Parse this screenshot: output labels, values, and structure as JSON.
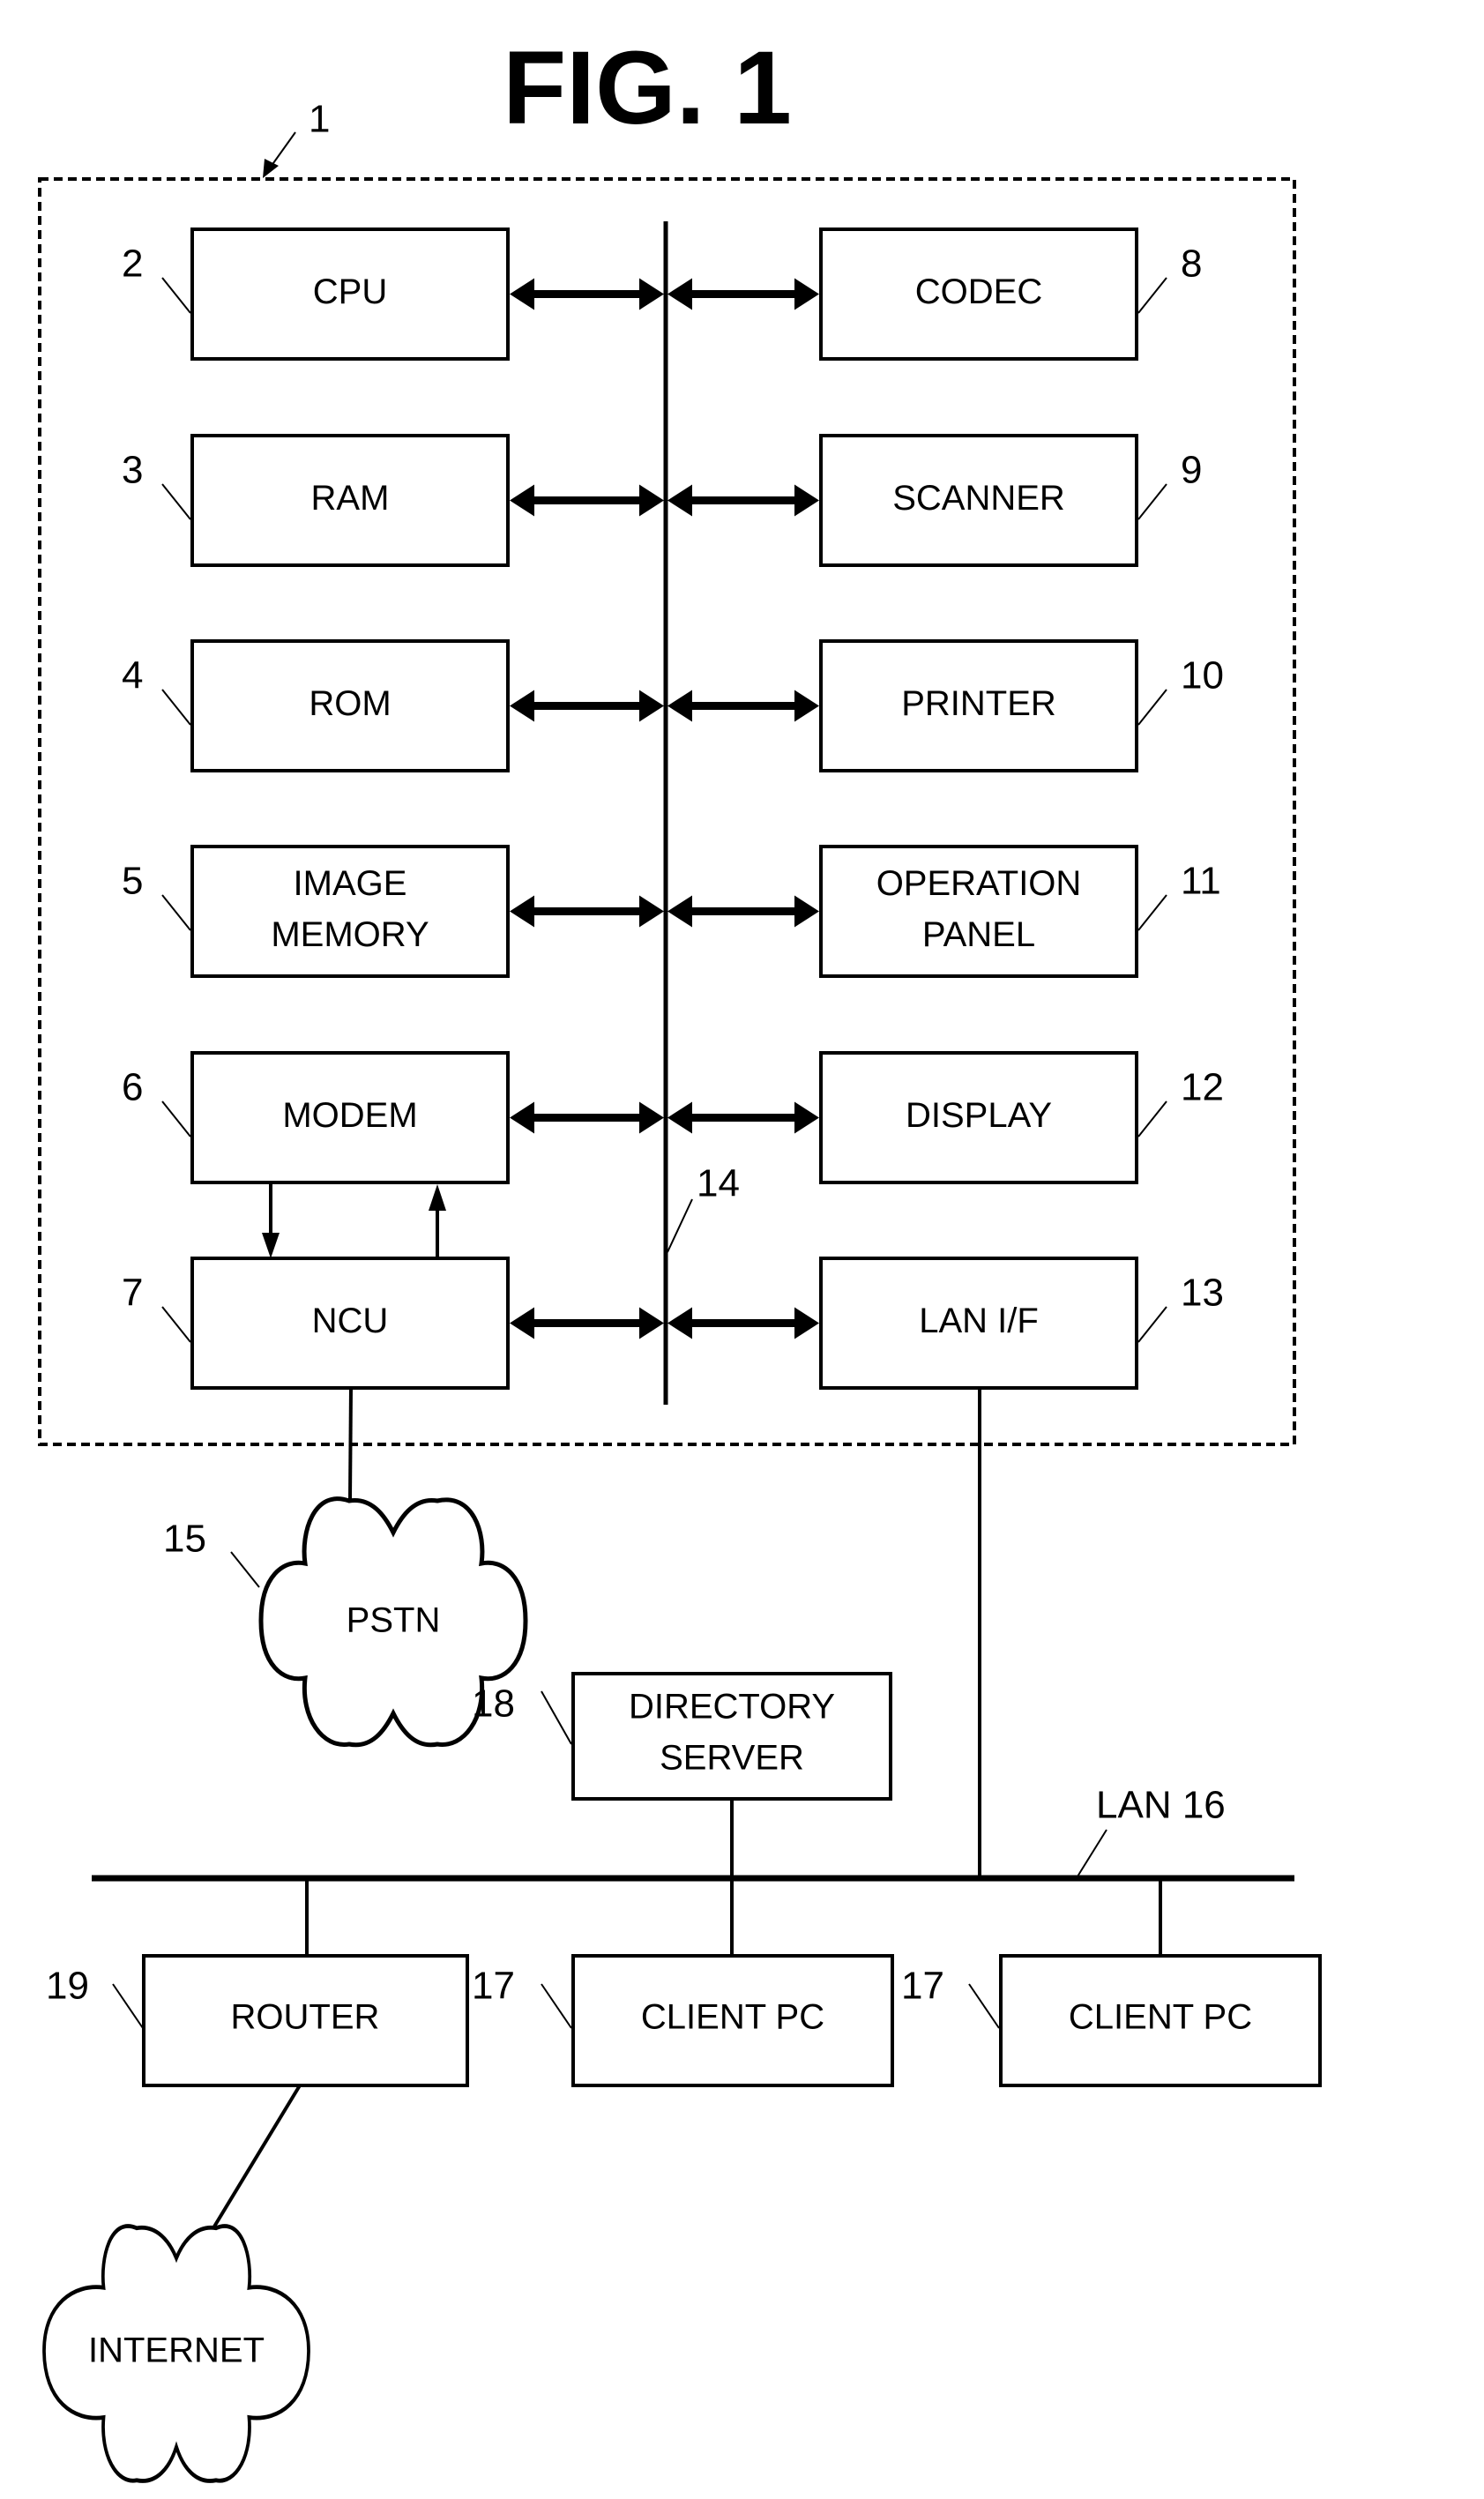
{
  "figure": {
    "title": "FIG. 1",
    "device_ref": "1",
    "bus_ref": "14"
  },
  "left_blocks": [
    {
      "ref": "2",
      "lines": [
        "CPU"
      ]
    },
    {
      "ref": "3",
      "lines": [
        "RAM"
      ]
    },
    {
      "ref": "4",
      "lines": [
        "ROM"
      ]
    },
    {
      "ref": "5",
      "lines": [
        "IMAGE",
        "MEMORY"
      ]
    },
    {
      "ref": "6",
      "lines": [
        "MODEM"
      ]
    },
    {
      "ref": "7",
      "lines": [
        "NCU"
      ]
    }
  ],
  "right_blocks": [
    {
      "ref": "8",
      "lines": [
        "CODEC"
      ]
    },
    {
      "ref": "9",
      "lines": [
        "SCANNER"
      ]
    },
    {
      "ref": "10",
      "lines": [
        "PRINTER"
      ]
    },
    {
      "ref": "11",
      "lines": [
        "OPERATION",
        "PANEL"
      ]
    },
    {
      "ref": "12",
      "lines": [
        "DISPLAY"
      ]
    },
    {
      "ref": "13",
      "lines": [
        "LAN I/F"
      ]
    }
  ],
  "network": {
    "pstn": {
      "ref": "15",
      "label": "PSTN"
    },
    "lan": {
      "label": "LAN 16"
    },
    "directory_server": {
      "ref": "18",
      "lines": [
        "DIRECTORY",
        "SERVER"
      ]
    },
    "router": {
      "ref": "19",
      "label": "ROUTER"
    },
    "client_pc_1": {
      "ref": "17",
      "label": "CLIENT PC"
    },
    "client_pc_2": {
      "ref": "17",
      "label": "CLIENT PC"
    },
    "internet": {
      "label": "INTERNET"
    }
  }
}
